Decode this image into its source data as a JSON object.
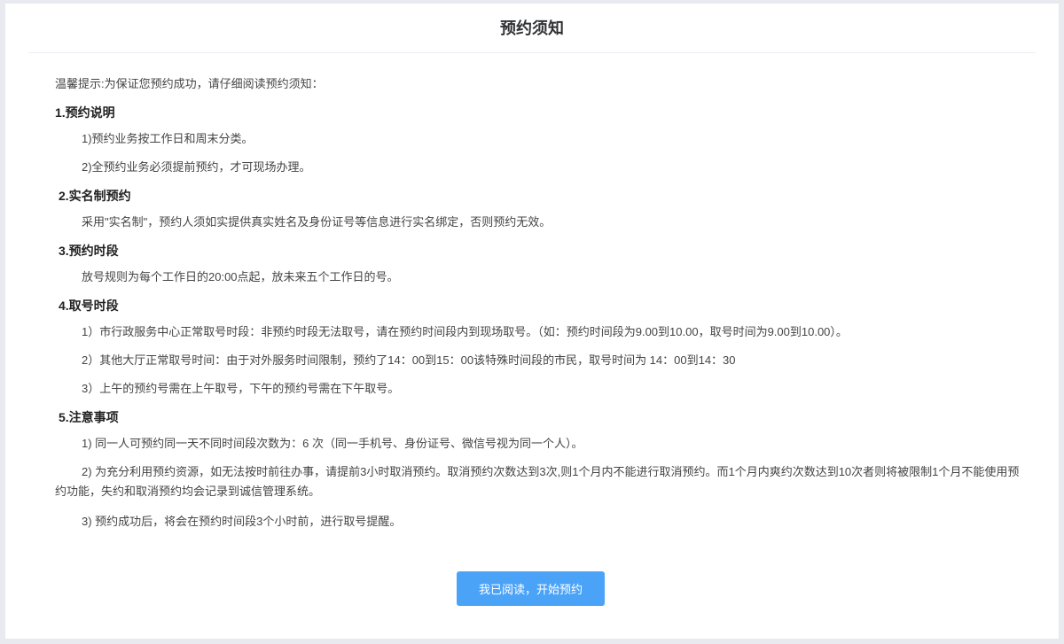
{
  "title": "预约须知",
  "tip": "温馨提示:为保证您预约成功，请仔细阅读预约须知：",
  "sections": [
    {
      "heading": "1.预约说明",
      "items": [
        "1)预约业务按工作日和周末分类。",
        "2)全预约业务必须提前预约，才可现场办理。"
      ]
    },
    {
      "heading": "2.实名制预约",
      "items": [
        "采用\"实名制\"，预约人须如实提供真实姓名及身份证号等信息进行实名绑定，否则预约无效。"
      ]
    },
    {
      "heading": "3.预约时段",
      "items": [
        "放号规则为每个工作日的20:00点起，放未来五个工作日的号。"
      ]
    },
    {
      "heading": "4.取号时段",
      "items": [
        "1）市行政服务中心正常取号时段：非预约时段无法取号，请在预约时间段内到现场取号。（如：预约时间段为9.00到10.00，取号时间为9.00到10.00）。",
        "2）其他大厅正常取号时间：由于对外服务时间限制，预约了14：00到15：00该特殊时间段的市民，取号时间为 14：00到14：30",
        "3）上午的预约号需在上午取号，下午的预约号需在下午取号。"
      ]
    },
    {
      "heading": "5.注意事项",
      "items": [
        "1) 同一人可预约同一天不同时间段次数为：6 次（同一手机号、身份证号、微信号视为同一个人）。",
        "2) 为充分利用预约资源，如无法按时前往办事，请提前3小时取消预约。取消预约次数达到3次,则1个月内不能进行取消预约。而1个月内爽约次数达到10次者则将被限制1个月不能使用预约功能，失约和取消预约均会记录到诚信管理系统。",
        "3) 预约成功后，将会在预约时间段3个小时前，进行取号提醒。"
      ]
    }
  ],
  "button": "我已阅读，开始预约"
}
